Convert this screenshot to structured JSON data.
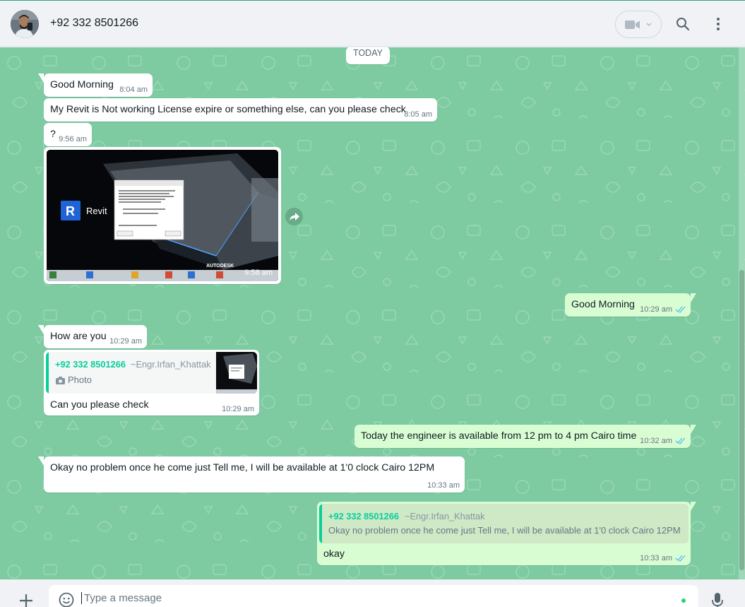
{
  "header": {
    "contact_name": "+92 332 8501266",
    "icons": {
      "video": "video-call-icon",
      "search": "search-icon",
      "menu": "kebab-menu-icon"
    }
  },
  "chat": {
    "date_label": "TODAY",
    "messages": [
      {
        "direction": "in",
        "text": "Good Morning",
        "time": "8:04 am"
      },
      {
        "direction": "in",
        "text": "My Revit is Not working License expire or something else, can you please check",
        "time": "8:05 am"
      },
      {
        "direction": "in",
        "text": "?",
        "time": "9:56 am"
      },
      {
        "direction": "in",
        "type": "image",
        "brand_text": "Revit",
        "watermark_text": "AUTODESK",
        "time": "9:58 am"
      },
      {
        "direction": "out",
        "text": "Good Morning",
        "time": "10:29 am",
        "status": "read"
      },
      {
        "direction": "in",
        "text": "How are you",
        "time": "10:29 am"
      },
      {
        "direction": "in",
        "quote": {
          "name": "+92 332 8501266",
          "alias": "~Engr.Irfan_Khattak",
          "body": "Photo"
        },
        "text": "Can you please check",
        "time": "10:29 am"
      },
      {
        "direction": "out",
        "text": "Today the engineer is available from 12 pm to 4 pm Cairo time",
        "time": "10:32 am",
        "status": "read"
      },
      {
        "direction": "in",
        "text": "Okay no problem once he come just Tell me, I will be available at 1'0 clock Cairo 12PM",
        "time": "10:33 am"
      },
      {
        "direction": "out",
        "quote": {
          "name": "+92 332 8501266",
          "alias": "~Engr.Irfan_Khattak",
          "body": "Okay no problem once he come just Tell me, I will be available at 1'0 clock Cairo 12PM"
        },
        "text": "okay",
        "time": "10:33 am",
        "status": "read"
      }
    ]
  },
  "composer": {
    "placeholder": "Type a message",
    "icons": {
      "attach": "plus-icon",
      "emoji": "emoji-icon",
      "mic": "microphone-icon"
    }
  },
  "colors": {
    "chat_background": "#7ecba2",
    "incoming_bubble": "#ffffff",
    "outgoing_bubble": "#d9fdd3",
    "accent": "#06cf9c",
    "read_ticks": "#53bdeb"
  }
}
